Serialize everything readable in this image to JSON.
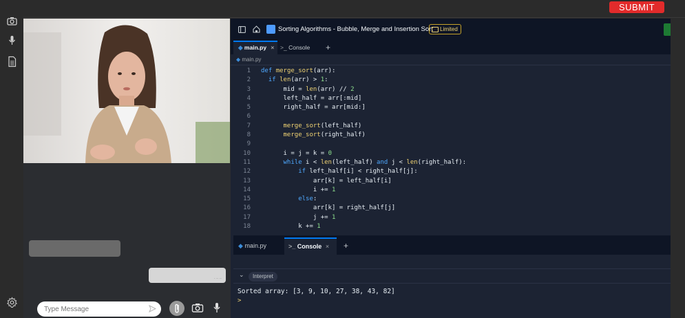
{
  "submit_label": "SUBMIT",
  "rail": {
    "icons": [
      "camera-icon",
      "microphone-icon",
      "document-icon",
      "settings-icon"
    ]
  },
  "chat": {
    "input_placeholder": "Type Message",
    "incoming_time": "",
    "outgoing_time": "- -- --"
  },
  "ide": {
    "project_title": "Sorting Algorithms - Bubble, Merge and Insertion Sort",
    "plan_badge": "Limited",
    "tabs": [
      {
        "label": "main.py"
      },
      {
        "label": "Console"
      }
    ],
    "breadcrumb": "main.py",
    "code_lines": [
      "def merge_sort(arr):",
      "  if len(arr) > 1:",
      "      mid = len(arr) // 2",
      "      left_half = arr[:mid]",
      "      right_half = arr[mid:]",
      "",
      "      merge_sort(left_half)",
      "      merge_sort(right_half)",
      "",
      "      i = j = k = 0",
      "      while i < len(left_half) and j < len(right_half):",
      "          if left_half[i] < right_half[j]:",
      "              arr[k] = left_half[i]",
      "              i += 1",
      "          else:",
      "              arr[k] = right_half[j]",
      "              j += 1",
      "          k += 1"
    ],
    "console": {
      "tabs": [
        {
          "label": "main.py"
        },
        {
          "label": "Console"
        }
      ],
      "interpret_label": "Interpret",
      "output": "Sorted array: [3, 9, 10, 27, 38, 43, 82]",
      "prompt": ">"
    }
  },
  "colors": {
    "submit": "#e22b2b",
    "editor_bg": "#1c2333",
    "accent": "#0079f2"
  }
}
